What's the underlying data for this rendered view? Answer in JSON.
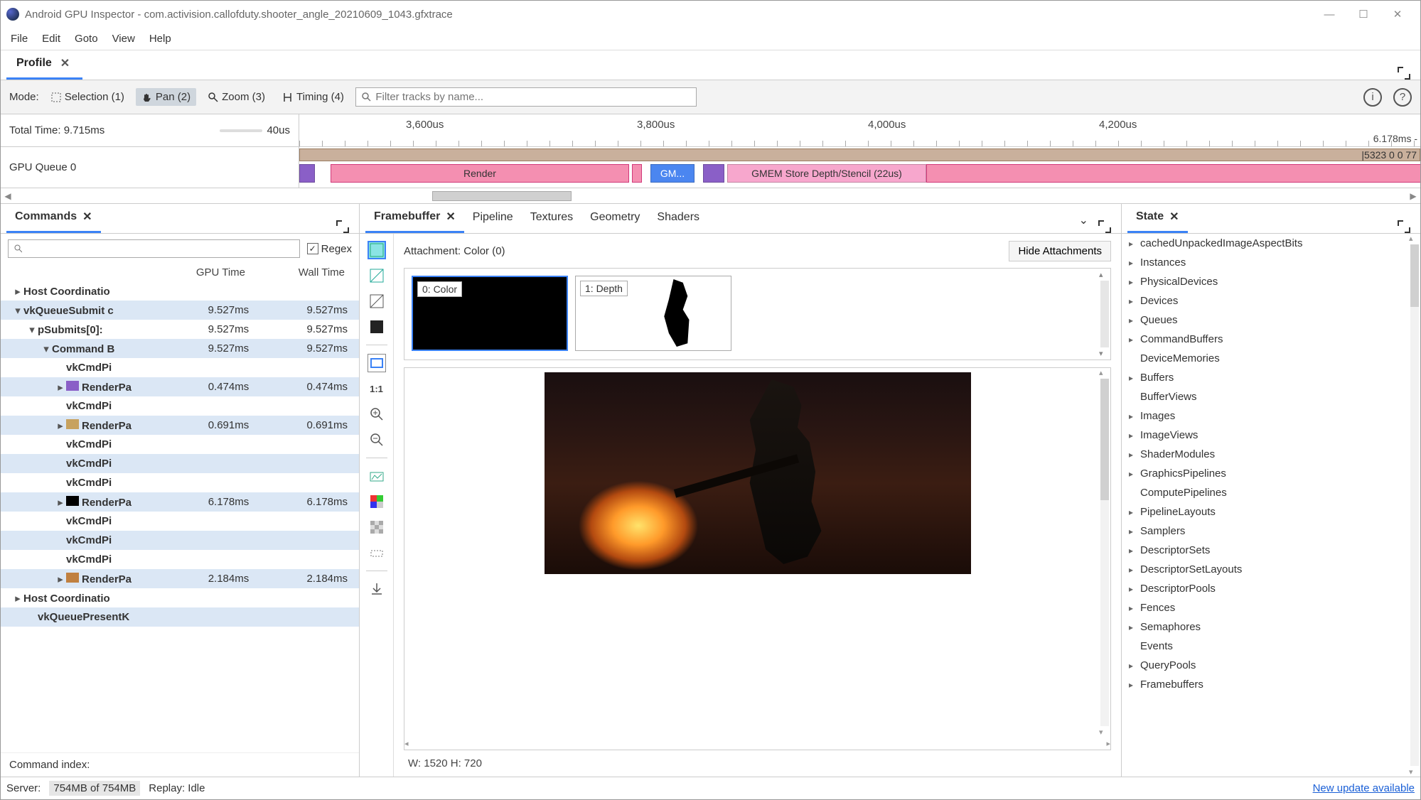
{
  "window": {
    "title": "Android GPU Inspector - com.activision.callofduty.shooter_angle_20210609_1043.gfxtrace"
  },
  "menu": [
    "File",
    "Edit",
    "Goto",
    "View",
    "Help"
  ],
  "profileTab": {
    "label": "Profile"
  },
  "toolbar": {
    "mode_label": "Mode:",
    "selection": "Selection (1)",
    "pan": "Pan (2)",
    "zoom": "Zoom (3)",
    "timing": "Timing (4)",
    "filter_placeholder": "Filter tracks by name..."
  },
  "timeline": {
    "total_time_label": "Total Time: 9.715ms",
    "range_label": "40us",
    "ticks": [
      "3,600us",
      "3,800us",
      "4,000us",
      "4,200us"
    ],
    "tail_right": "6.178ms -",
    "track_label": "GPU Queue 0",
    "top_right": "|5323 0 0 77",
    "blocks": {
      "render": "Render",
      "gm": "GM...",
      "store": "GMEM Store Depth/Stencil (22us)"
    }
  },
  "commands": {
    "tab": "Commands",
    "regex": "Regex",
    "col_gpu": "GPU Time",
    "col_wall": "Wall Time",
    "footer_label": "Command index:",
    "rows": [
      {
        "indent": 0,
        "expander": "▸",
        "bold": true,
        "label": "Host Coordinatio"
      },
      {
        "indent": 0,
        "expander": "▾",
        "bold": true,
        "label": "vkQueueSubmit c",
        "gpu": "9.527ms",
        "wall": "9.527ms",
        "sel": true
      },
      {
        "indent": 1,
        "expander": "▾",
        "bold": true,
        "label": "pSubmits[0]:",
        "gpu": "9.527ms",
        "wall": "9.527ms"
      },
      {
        "indent": 2,
        "expander": "▾",
        "bold": true,
        "label": "Command B",
        "gpu": "9.527ms",
        "wall": "9.527ms",
        "sel": true
      },
      {
        "indent": 3,
        "expander": "",
        "bold": true,
        "label": "vkCmdPi"
      },
      {
        "indent": 3,
        "expander": "▸",
        "bold": true,
        "label": "RenderPa",
        "gpu": "0.474ms",
        "wall": "0.474ms",
        "icon": "#8a5fc7",
        "sel": true
      },
      {
        "indent": 3,
        "expander": "",
        "bold": true,
        "label": "vkCmdPi"
      },
      {
        "indent": 3,
        "expander": "▸",
        "bold": true,
        "label": "RenderPa",
        "gpu": "0.691ms",
        "wall": "0.691ms",
        "icon": "#c7a25f",
        "sel": true
      },
      {
        "indent": 3,
        "expander": "",
        "bold": true,
        "label": "vkCmdPi"
      },
      {
        "indent": 3,
        "expander": "",
        "bold": true,
        "label": "vkCmdPi",
        "sel": true
      },
      {
        "indent": 3,
        "expander": "",
        "bold": true,
        "label": "vkCmdPi"
      },
      {
        "indent": 3,
        "expander": "▸",
        "bold": true,
        "label": "RenderPa",
        "gpu": "6.178ms",
        "wall": "6.178ms",
        "icon": "#000",
        "sel": true
      },
      {
        "indent": 3,
        "expander": "",
        "bold": true,
        "label": "vkCmdPi"
      },
      {
        "indent": 3,
        "expander": "",
        "bold": true,
        "label": "vkCmdPi",
        "sel": true
      },
      {
        "indent": 3,
        "expander": "",
        "bold": true,
        "label": "vkCmdPi"
      },
      {
        "indent": 3,
        "expander": "▸",
        "bold": true,
        "label": "RenderPa",
        "gpu": "2.184ms",
        "wall": "2.184ms",
        "icon": "#c08040",
        "sel": true
      },
      {
        "indent": 0,
        "expander": "▸",
        "bold": true,
        "label": "Host Coordinatio"
      },
      {
        "indent": 1,
        "expander": "",
        "bold": true,
        "label": "vkQueuePresentK",
        "sel": true
      }
    ]
  },
  "framebuffer": {
    "tabs": [
      "Framebuffer",
      "Pipeline",
      "Textures",
      "Geometry",
      "Shaders"
    ],
    "attachment_label": "Attachment: Color (0)",
    "hide_btn": "Hide Attachments",
    "thumb0": "0: Color",
    "thumb1": "1: Depth",
    "dims": "W: 1520 H: 720"
  },
  "state": {
    "tab": "State",
    "items": [
      {
        "caret": "▸",
        "label": "cachedUnpackedImageAspectBits"
      },
      {
        "caret": "▸",
        "label": "Instances"
      },
      {
        "caret": "▸",
        "label": "PhysicalDevices"
      },
      {
        "caret": "▸",
        "label": "Devices"
      },
      {
        "caret": "▸",
        "label": "Queues"
      },
      {
        "caret": "▸",
        "label": "CommandBuffers"
      },
      {
        "caret": "",
        "label": "DeviceMemories"
      },
      {
        "caret": "▸",
        "label": "Buffers"
      },
      {
        "caret": "",
        "label": "BufferViews"
      },
      {
        "caret": "▸",
        "label": "Images"
      },
      {
        "caret": "▸",
        "label": "ImageViews"
      },
      {
        "caret": "▸",
        "label": "ShaderModules"
      },
      {
        "caret": "▸",
        "label": "GraphicsPipelines"
      },
      {
        "caret": "",
        "label": "ComputePipelines"
      },
      {
        "caret": "▸",
        "label": "PipelineLayouts"
      },
      {
        "caret": "▸",
        "label": "Samplers"
      },
      {
        "caret": "▸",
        "label": "DescriptorSets"
      },
      {
        "caret": "▸",
        "label": "DescriptorSetLayouts"
      },
      {
        "caret": "▸",
        "label": "DescriptorPools"
      },
      {
        "caret": "▸",
        "label": "Fences"
      },
      {
        "caret": "▸",
        "label": "Semaphores"
      },
      {
        "caret": "",
        "label": "Events"
      },
      {
        "caret": "▸",
        "label": "QueryPools"
      },
      {
        "caret": "▸",
        "label": "Framebuffers"
      }
    ]
  },
  "status": {
    "server_label": "Server:",
    "server_mem": "754MB of 754MB",
    "replay": "Replay: Idle",
    "update": "New update available"
  }
}
